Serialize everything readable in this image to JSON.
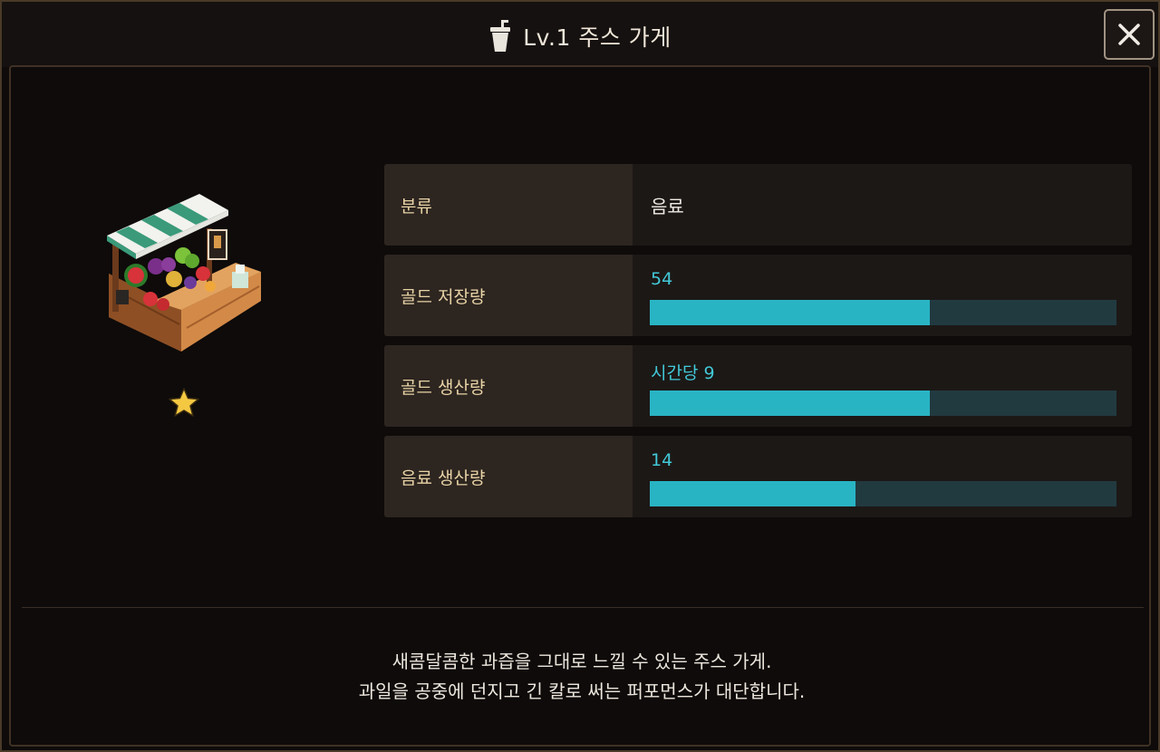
{
  "header": {
    "title": "Lv.1 주스 가게",
    "icon": "juice-cup-icon",
    "close_icon": "close-icon"
  },
  "shop": {
    "image": "juice-stand-image",
    "stars": 1
  },
  "stats": [
    {
      "label": "분류",
      "value": "음료"
    },
    {
      "label": "골드 저장량",
      "value": "54",
      "progress": 0.6
    },
    {
      "label": "골드 생산량",
      "value": "시간당 9",
      "progress": 0.6
    },
    {
      "label": "음료 생산량",
      "value": "14",
      "progress": 0.44
    }
  ],
  "description": {
    "line1": "새콤달콤한 과즙을 그대로 느낄 수 있는 주스 가게.",
    "line2": "과일을 공중에 던지고 긴 칼로 써는 퍼포먼스가 대단합니다."
  },
  "colors": {
    "accent": "#29b4c4",
    "bar_track": "#213a40",
    "label_text": "#e8d3a6",
    "star": "#f5c842"
  }
}
